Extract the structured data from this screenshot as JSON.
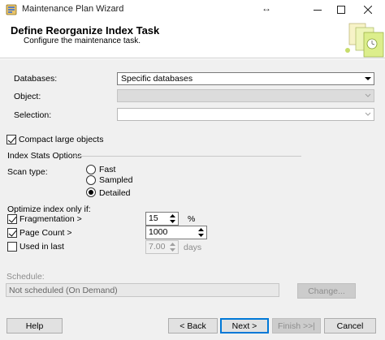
{
  "window": {
    "title": "Maintenance Plan Wizard",
    "minimize_icon": "minimize-icon",
    "maximize_icon": "maximize-icon",
    "close_icon": "close-icon"
  },
  "header": {
    "title": "Define Reorganize Index Task",
    "subtitle": "Configure the maintenance task."
  },
  "form": {
    "databases_label": "Databases:",
    "databases_value": "Specific databases",
    "object_label": "Object:",
    "object_value": "",
    "selection_label": "Selection:",
    "selection_value": "",
    "compact_label": "Compact large objects",
    "compact_checked": true
  },
  "index_stats": {
    "group_label": "Index Stats Options",
    "scan_type_label": "Scan type:",
    "options": [
      {
        "label": "Fast",
        "selected": false
      },
      {
        "label": "Sampled",
        "selected": false
      },
      {
        "label": "Detailed",
        "selected": true
      }
    ]
  },
  "optimize": {
    "label": "Optimize index only if:",
    "fragmentation_label": "Fragmentation >",
    "fragmentation_checked": true,
    "fragmentation_value": "15",
    "fragmentation_unit": "%",
    "page_count_label": "Page Count >",
    "page_count_checked": true,
    "page_count_value": "1000",
    "used_label": "Used  in last",
    "used_checked": false,
    "used_value": "7.00",
    "used_unit": "days"
  },
  "schedule": {
    "label": "Schedule:",
    "value": "Not scheduled (On Demand)",
    "change_button": "Change..."
  },
  "footer": {
    "help": "Help",
    "back": "< Back",
    "next": "Next >",
    "finish": "Finish >>|",
    "cancel": "Cancel"
  },
  "colors": {
    "body_bg": "#f0f0f0",
    "default_button_border": "#0078d7"
  }
}
